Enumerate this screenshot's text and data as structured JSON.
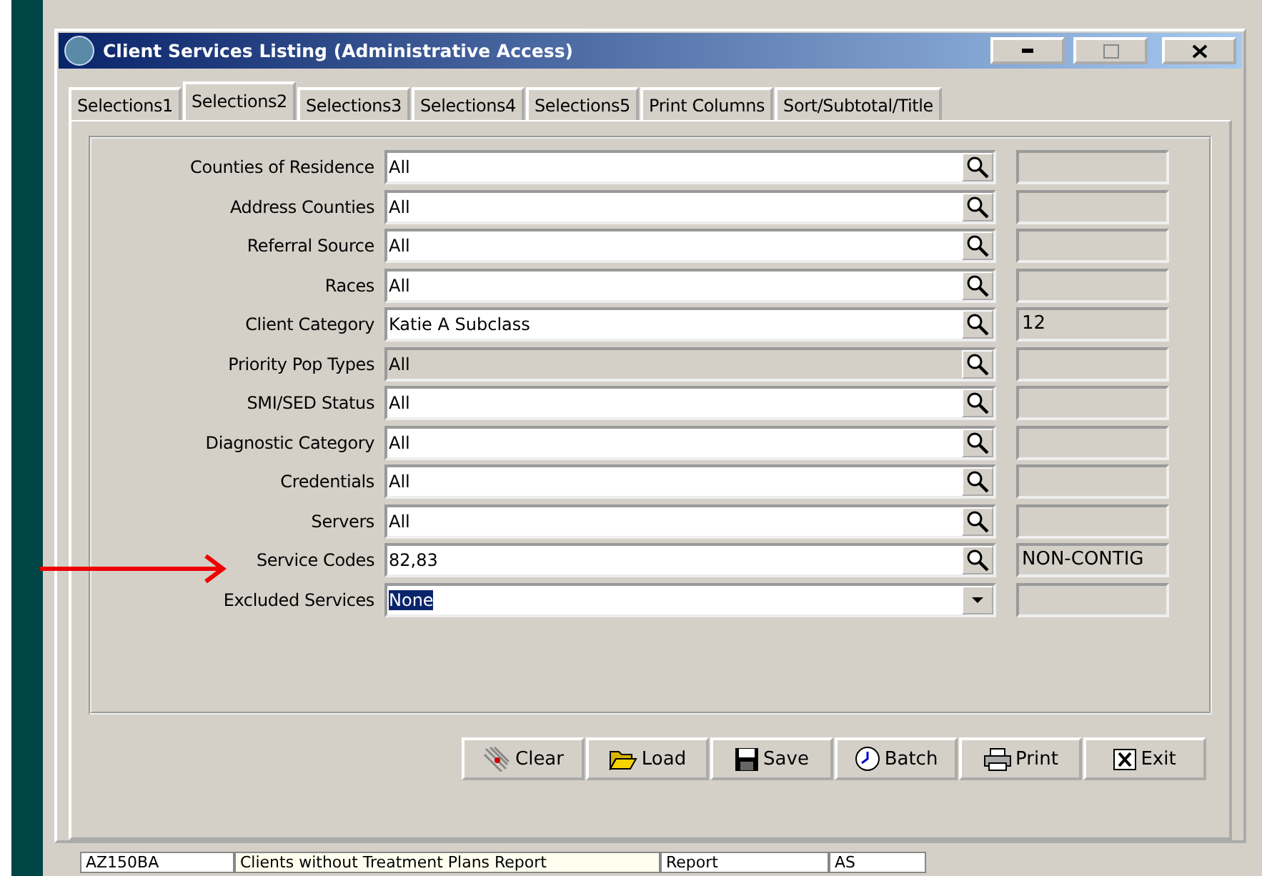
{
  "window": {
    "title": "Client Services Listing (Administrative Access)"
  },
  "tabs": [
    {
      "label": "Selections1",
      "selected": false
    },
    {
      "label": "Selections2",
      "selected": true
    },
    {
      "label": "Selections3",
      "selected": false
    },
    {
      "label": "Selections4",
      "selected": false
    },
    {
      "label": "Selections5",
      "selected": false
    },
    {
      "label": "Print Columns",
      "selected": false
    },
    {
      "label": "Sort/Subtotal/Title",
      "selected": false
    }
  ],
  "fields": [
    {
      "label": "Counties of Residence",
      "value": "All",
      "kind": "lookup",
      "disabled": false,
      "highlighted": false
    },
    {
      "label": "Address Counties",
      "value": "All",
      "kind": "lookup",
      "disabled": false,
      "highlighted": false
    },
    {
      "label": "Referral Source",
      "value": "All",
      "kind": "lookup",
      "disabled": false,
      "highlighted": false
    },
    {
      "label": "Races",
      "value": "All",
      "kind": "lookup",
      "disabled": false,
      "highlighted": false
    },
    {
      "label": "Client Category",
      "value": "Katie A Subclass",
      "kind": "lookup",
      "disabled": false,
      "highlighted": false,
      "extra": "12"
    },
    {
      "label": "Priority Pop Types",
      "value": "All",
      "kind": "lookup",
      "disabled": true,
      "highlighted": false
    },
    {
      "label": "SMI/SED Status",
      "value": "All",
      "kind": "lookup",
      "disabled": false,
      "highlighted": false
    },
    {
      "label": "Diagnostic Category",
      "value": "All",
      "kind": "lookup",
      "disabled": false,
      "highlighted": false
    },
    {
      "label": "Credentials",
      "value": "All",
      "kind": "lookup",
      "disabled": false,
      "highlighted": false
    },
    {
      "label": "Servers",
      "value": "All",
      "kind": "lookup",
      "disabled": false,
      "highlighted": false
    },
    {
      "label": "Service Codes",
      "value": "82,83",
      "kind": "lookup",
      "disabled": false,
      "highlighted": false,
      "extra": "NON-CONTIG",
      "pointed": true
    },
    {
      "label": "Excluded Services",
      "value": "None",
      "kind": "dropdown",
      "disabled": false,
      "highlighted": true
    }
  ],
  "buttons": [
    {
      "label": "Clear",
      "kind": "clear"
    },
    {
      "label": "Load",
      "kind": "load"
    },
    {
      "label": "Save",
      "kind": "save"
    },
    {
      "label": "Batch",
      "kind": "batch"
    },
    {
      "label": "Print",
      "kind": "print"
    },
    {
      "label": "Exit",
      "kind": "exit"
    }
  ],
  "background_row": {
    "cells": [
      "AZ150BA",
      "Clients without Treatment Plans Report",
      "Report",
      "AS"
    ]
  }
}
